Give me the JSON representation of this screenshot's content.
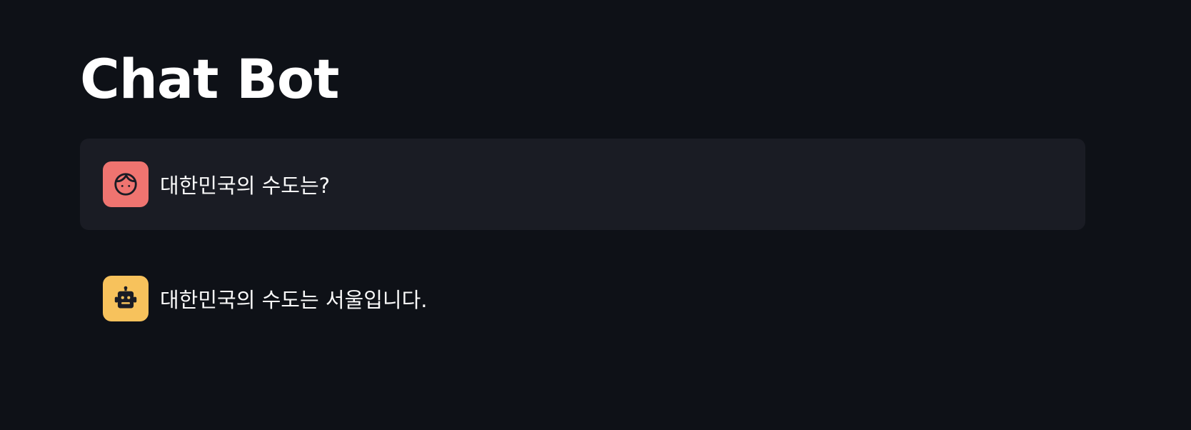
{
  "app": {
    "title": "Chat Bot"
  },
  "messages": [
    {
      "role": "user",
      "avatar_icon": "face-icon",
      "avatar_color": "#ef7470",
      "text": "대한민국의 수도는?"
    },
    {
      "role": "assistant",
      "avatar_icon": "robot-icon",
      "avatar_color": "#f7c25c",
      "text": "대한민국의 수도는 서울입니다."
    }
  ],
  "colors": {
    "background": "#0e1117",
    "user_bubble": "#1a1c24",
    "text": "#fafafa"
  }
}
